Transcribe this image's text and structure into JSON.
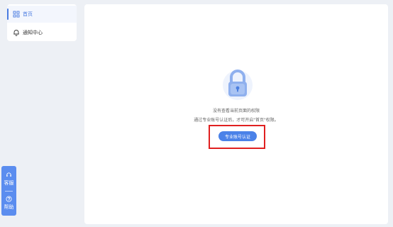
{
  "sidebar": {
    "items": [
      {
        "label": "首页",
        "icon": "grid-icon",
        "active": true
      },
      {
        "label": "通知中心",
        "icon": "bell-icon",
        "active": false
      }
    ]
  },
  "main": {
    "icon": "lock-icon",
    "message_line1": "没有查看当前页面的权限",
    "message_line2": "通过专业账号认证后，才可开启\"首页\"权限。",
    "verify_button_label": "专业账号认证"
  },
  "float_bar": {
    "service_label": "客服",
    "service_icon": "headset-icon",
    "help_label": "帮助",
    "help_icon": "help-icon"
  },
  "colors": {
    "accent": "#4b82e8",
    "highlight": "#e02020",
    "background": "#edf0f5"
  }
}
